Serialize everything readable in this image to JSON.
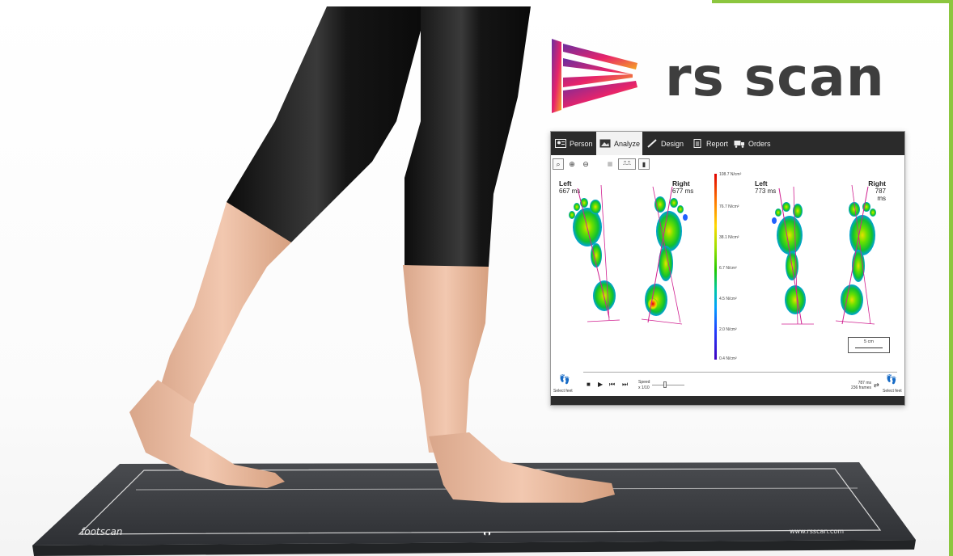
{
  "brand": {
    "name": "rs scan",
    "logo_icon": "rs-scan-chevron-logo-icon",
    "logo_gradient": [
      "#6a2ea0",
      "#e8236a",
      "#f5a623"
    ]
  },
  "app": {
    "tabs": [
      {
        "label": "Person",
        "icon": "person-card-icon"
      },
      {
        "label": "Analyze",
        "icon": "image-icon",
        "active": true
      },
      {
        "label": "Design",
        "icon": "pencil-icon"
      },
      {
        "label": "Report",
        "icon": "document-icon"
      },
      {
        "label": "Orders",
        "icon": "truck-icon"
      }
    ],
    "toolbar": [
      "zoom-fit-icon",
      "zoom-in-icon",
      "zoom-out-icon",
      "grid-icon",
      "view-mode-icons"
    ],
    "feet": [
      {
        "side": "Left",
        "duration": "667 ms"
      },
      {
        "side": "Right",
        "duration": "677 ms"
      },
      {
        "side": "Left",
        "duration": "773 ms"
      },
      {
        "side": "Right",
        "duration": "787 ms"
      }
    ],
    "pressure_scale": [
      "108.7 N/cm²",
      "76.7 N/cm²",
      "38.1 N/cm²",
      "6.7 N/cm²",
      "4.5 N/cm²",
      "2.0 N/cm²",
      "0.4 N/cm²"
    ],
    "scale_bar": "5 cm",
    "controls": {
      "select_feet_left": "Select feet",
      "select_feet_right": "Select feet",
      "speed_label": "Speed",
      "speed_value": "x 1/10",
      "time": "787 ms",
      "frames": "236 frames"
    }
  },
  "mat": {
    "brand_left": "footscan",
    "url": "www.rsscan.com"
  },
  "colors": {
    "accent_green": "#8cc63f",
    "tabbar": "#2b2b2b",
    "mat": "#3a3c40"
  }
}
